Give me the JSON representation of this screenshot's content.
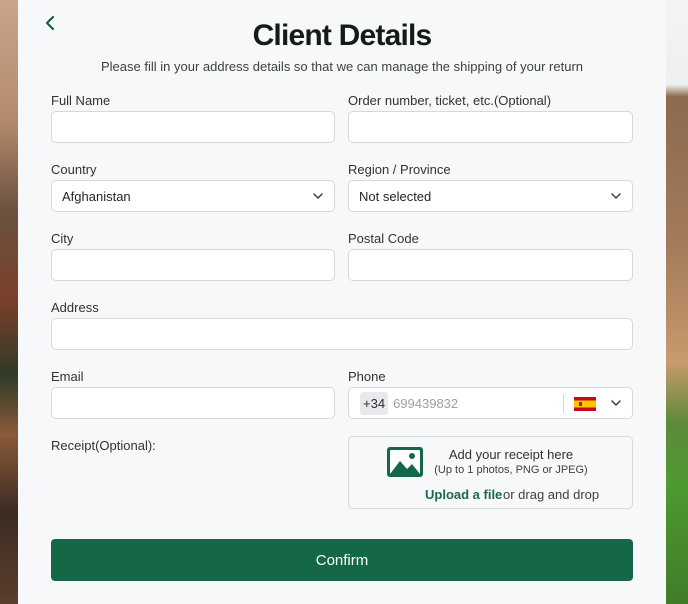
{
  "header": {
    "title": "Client Details",
    "subtitle": "Please fill in your address details so that we can manage the shipping of your return"
  },
  "form": {
    "full_name": {
      "label": "Full Name",
      "value": ""
    },
    "order_number": {
      "label": "Order number, ticket, etc.(Optional)",
      "value": ""
    },
    "country": {
      "label": "Country",
      "value": "Afghanistan"
    },
    "region": {
      "label": "Region / Province",
      "value": "Not selected"
    },
    "city": {
      "label": "City",
      "value": ""
    },
    "postal_code": {
      "label": "Postal Code",
      "value": ""
    },
    "address": {
      "label": "Address",
      "value": ""
    },
    "email": {
      "label": "Email",
      "value": ""
    },
    "phone": {
      "label": "Phone",
      "country_code": "+34",
      "placeholder": "699439832",
      "flag": "spain-flag-icon"
    },
    "receipt": {
      "label": "Receipt(Optional):",
      "title": "Add your receipt here",
      "hint": "(Up to 1 photos, PNG or JPEG)",
      "upload_link": "Upload a file",
      "drag_text": "or drag and drop",
      "icon": "image-icon"
    }
  },
  "actions": {
    "confirm_label": "Confirm"
  },
  "colors": {
    "accent": "#156847",
    "link": "#1a6a4b",
    "background": "#f7f8f9"
  }
}
